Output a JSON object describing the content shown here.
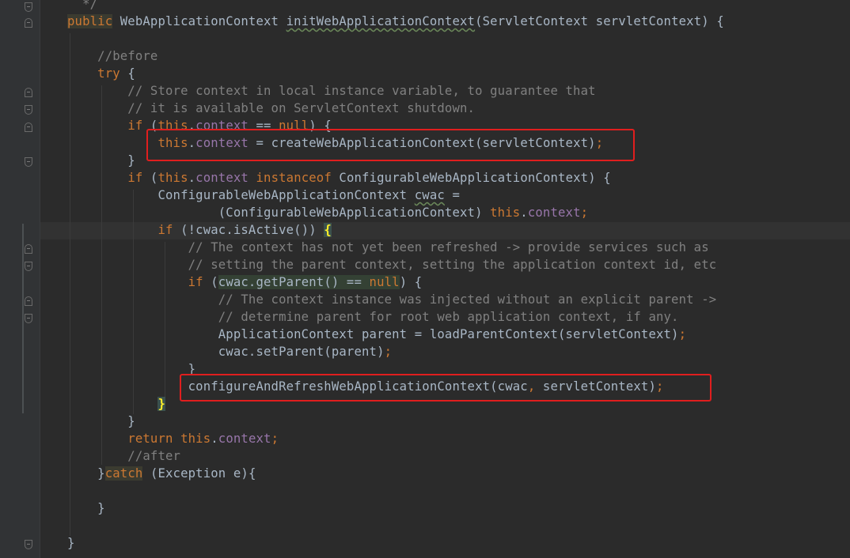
{
  "editor": {
    "lines": [
      [
        {
          "t": "  */",
          "c": "cm"
        }
      ],
      [
        {
          "t": "public",
          "c": "kw hl-kw"
        },
        {
          "t": " WebApplicationContext ",
          "c": ""
        },
        {
          "t": "initWebApplicationContext",
          "c": "ul-wave"
        },
        {
          "t": "(ServletContext servletContext) {",
          "c": ""
        }
      ],
      [],
      [
        {
          "t": "    //before",
          "c": "cm"
        }
      ],
      [
        {
          "t": "    ",
          "c": ""
        },
        {
          "t": "try",
          "c": "kw"
        },
        {
          "t": " {",
          "c": ""
        }
      ],
      [
        {
          "t": "        // Store context in local instance variable, to guarantee that",
          "c": "cm"
        }
      ],
      [
        {
          "t": "        // it is available on ServletContext shutdown.",
          "c": "cm"
        }
      ],
      [
        {
          "t": "        ",
          "c": ""
        },
        {
          "t": "if",
          "c": "kw"
        },
        {
          "t": " (",
          "c": ""
        },
        {
          "t": "this",
          "c": "kw"
        },
        {
          "t": ".",
          "c": ""
        },
        {
          "t": "context",
          "c": "fld"
        },
        {
          "t": " == ",
          "c": ""
        },
        {
          "t": "null",
          "c": "kw"
        },
        {
          "t": ") {",
          "c": ""
        }
      ],
      [
        {
          "t": "            ",
          "c": ""
        },
        {
          "t": "this",
          "c": "kw"
        },
        {
          "t": ".",
          "c": ""
        },
        {
          "t": "context",
          "c": "fld"
        },
        {
          "t": " = createWebApplicationContext(servletContext)",
          "c": ""
        },
        {
          "t": ";",
          "c": "semi"
        }
      ],
      [
        {
          "t": "        }",
          "c": ""
        }
      ],
      [
        {
          "t": "        ",
          "c": ""
        },
        {
          "t": "if",
          "c": "kw"
        },
        {
          "t": " (",
          "c": ""
        },
        {
          "t": "this",
          "c": "kw"
        },
        {
          "t": ".",
          "c": ""
        },
        {
          "t": "context",
          "c": "fld"
        },
        {
          "t": " ",
          "c": ""
        },
        {
          "t": "instanceof",
          "c": "kw"
        },
        {
          "t": " ConfigurableWebApplicationContext) {",
          "c": ""
        }
      ],
      [
        {
          "t": "            ConfigurableWebApplicationContext ",
          "c": ""
        },
        {
          "t": "cwac",
          "c": "ul-wave"
        },
        {
          "t": " =",
          "c": ""
        }
      ],
      [
        {
          "t": "                    (ConfigurableWebApplicationContext) ",
          "c": ""
        },
        {
          "t": "this",
          "c": "kw"
        },
        {
          "t": ".",
          "c": ""
        },
        {
          "t": "context",
          "c": "fld"
        },
        {
          "t": ";",
          "c": "semi"
        }
      ],
      [
        {
          "t": "            ",
          "c": ""
        },
        {
          "t": "if",
          "c": "kw"
        },
        {
          "t": " (!cwac.isActive()) ",
          "c": ""
        },
        {
          "t": "{",
          "c": "brace-match"
        }
      ],
      [
        {
          "t": "                // The context has not yet been refreshed -> provide services such as",
          "c": "cm"
        }
      ],
      [
        {
          "t": "                // setting the parent context, setting the application context id, etc",
          "c": "cm"
        }
      ],
      [
        {
          "t": "                ",
          "c": ""
        },
        {
          "t": "if",
          "c": "kw"
        },
        {
          "t": " (",
          "c": ""
        },
        {
          "t": "cwac.getParent() == ",
          "c": "hl-occ"
        },
        {
          "t": "null",
          "c": "kw hl-occ"
        },
        {
          "t": ") {",
          "c": ""
        }
      ],
      [
        {
          "t": "                    // The context instance was injected without an explicit parent ->",
          "c": "cm"
        }
      ],
      [
        {
          "t": "                    // determine parent for root web application context, if any.",
          "c": "cm"
        }
      ],
      [
        {
          "t": "                    ApplicationContext parent = loadParentContext(servletContext)",
          "c": ""
        },
        {
          "t": ";",
          "c": "semi"
        }
      ],
      [
        {
          "t": "                    cwac.setParent(parent)",
          "c": ""
        },
        {
          "t": ";",
          "c": "semi"
        }
      ],
      [
        {
          "t": "                }",
          "c": ""
        }
      ],
      [
        {
          "t": "                configureAndRefreshWebApplicationContext(cwac",
          "c": ""
        },
        {
          "t": ",",
          "c": "semi"
        },
        {
          "t": " servletContext)",
          "c": ""
        },
        {
          "t": ";",
          "c": "semi"
        }
      ],
      [
        {
          "t": "            ",
          "c": ""
        },
        {
          "t": "}",
          "c": "brace-match"
        }
      ],
      [
        {
          "t": "        }",
          "c": ""
        }
      ],
      [
        {
          "t": "        ",
          "c": ""
        },
        {
          "t": "return",
          "c": "kw"
        },
        {
          "t": " ",
          "c": ""
        },
        {
          "t": "this",
          "c": "kw"
        },
        {
          "t": ".",
          "c": ""
        },
        {
          "t": "context",
          "c": "fld"
        },
        {
          "t": ";",
          "c": "semi"
        }
      ],
      [
        {
          "t": "        //after",
          "c": "cm"
        }
      ],
      [
        {
          "t": "    }",
          "c": ""
        },
        {
          "t": "catch",
          "c": "kw hl-kw"
        },
        {
          "t": " (Exception e){",
          "c": ""
        }
      ],
      [],
      [
        {
          "t": "    }",
          "c": ""
        }
      ],
      [],
      [
        {
          "t": "}",
          "c": ""
        }
      ]
    ]
  },
  "colors": {
    "background": "#2b2b2b",
    "keyword": "#cc7832",
    "comment": "#808080",
    "field": "#9876aa",
    "text": "#a9b7c6",
    "highlight_box": "#e01e1e"
  }
}
